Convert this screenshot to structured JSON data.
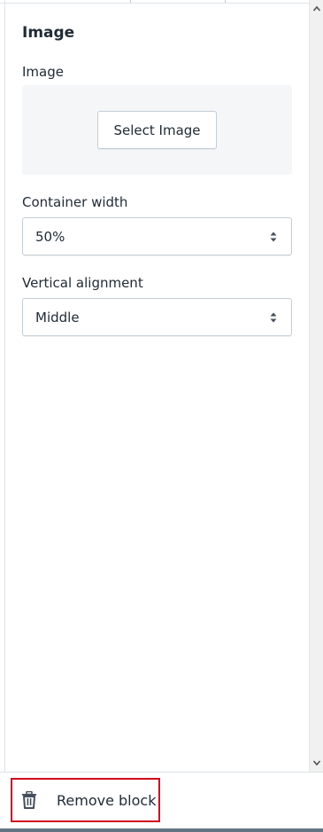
{
  "panel": {
    "section_title": "Image",
    "image_label": "Image",
    "select_image_label": "Select Image",
    "container_width": {
      "label": "Container width",
      "value": "50%"
    },
    "vertical_alignment": {
      "label": "Vertical alignment",
      "value": "Middle"
    }
  },
  "footer": {
    "remove_label": "Remove block",
    "highlight_color": "#d0021b"
  },
  "icons": {
    "remove": "trash-icon",
    "select_caret": "select-caret-icon",
    "scroll_up": "chevron-up-icon",
    "scroll_down": "chevron-down-icon"
  }
}
